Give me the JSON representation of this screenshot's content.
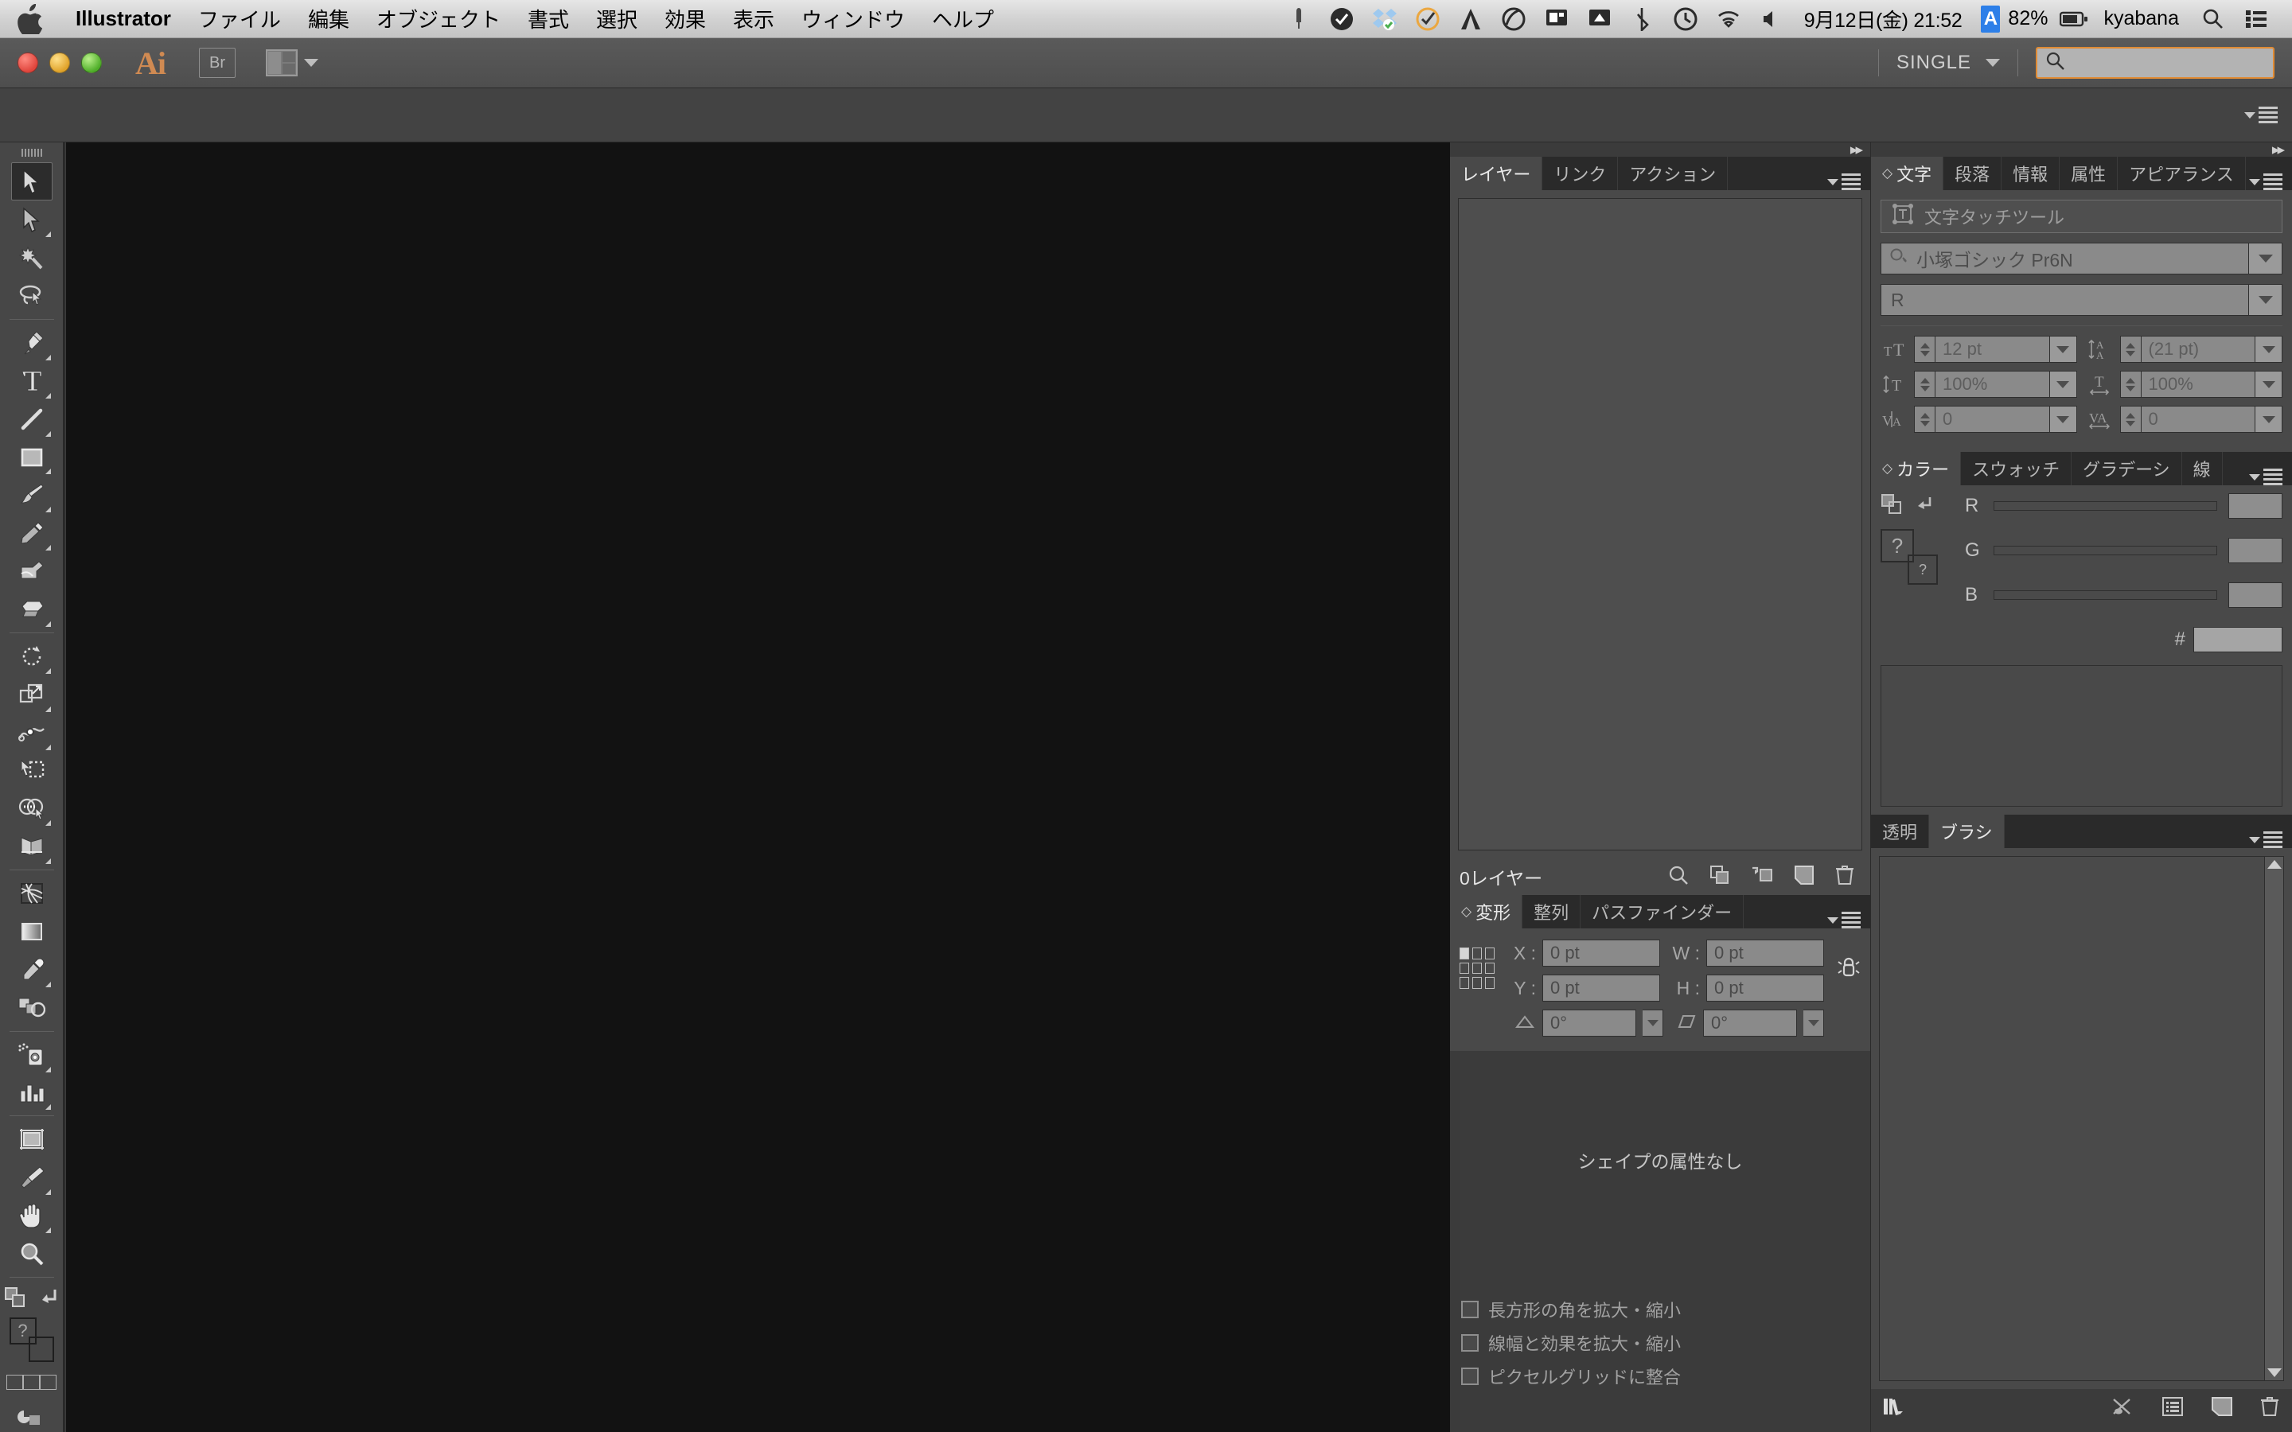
{
  "macbar": {
    "apple_icon": "apple-logo-icon",
    "app_name": "Illustrator",
    "menus": [
      "ファイル",
      "編集",
      "オブジェクト",
      "書式",
      "選択",
      "効果",
      "表示",
      "ウィンドウ",
      "ヘルプ"
    ],
    "status_icons": [
      "bell-icon",
      "checkmark-circle-icon",
      "dropbox-icon",
      "checkmark-orange-icon",
      "app-a-icon",
      "creative-cloud-icon",
      "display-icon",
      "airplay-icon",
      "bluetooth-icon",
      "timemachine-icon",
      "wifi-icon",
      "volume-icon"
    ],
    "clock": "9月12日(金) 21:52",
    "ime": "A",
    "battery_pct": "82%",
    "battery_icon": "battery-icon",
    "user": "kyabana",
    "spotlight_icon": "search-icon",
    "notification_icon": "list-icon"
  },
  "titlebar": {
    "app_logo": "Ai",
    "bridge_label": "Br",
    "arrange_icon": "arrange-documents-icon",
    "workspace": "SINGLE",
    "workspace_caret": "chevron-down-icon",
    "search_icon": "search-icon",
    "search_value": "",
    "search_placeholder": ""
  },
  "control_bar": {
    "panel_menu_icon": "panel-menu-icon"
  },
  "toolbar": {
    "tools": [
      {
        "name": "selection-tool",
        "active": true,
        "has_flyout": false
      },
      {
        "name": "direct-selection-tool",
        "active": false,
        "has_flyout": true
      },
      {
        "name": "magic-wand-tool",
        "active": false,
        "has_flyout": false
      },
      {
        "name": "lasso-tool",
        "active": false,
        "has_flyout": false
      },
      {
        "name": "pen-tool",
        "active": false,
        "has_flyout": true
      },
      {
        "name": "type-tool",
        "active": false,
        "has_flyout": true
      },
      {
        "name": "line-segment-tool",
        "active": false,
        "has_flyout": true
      },
      {
        "name": "rectangle-tool",
        "active": false,
        "has_flyout": true
      },
      {
        "name": "paintbrush-tool",
        "active": false,
        "has_flyout": true
      },
      {
        "name": "pencil-tool",
        "active": false,
        "has_flyout": true
      },
      {
        "name": "blob-brush-tool",
        "active": false,
        "has_flyout": false
      },
      {
        "name": "eraser-tool",
        "active": false,
        "has_flyout": true
      },
      {
        "name": "rotate-tool",
        "active": false,
        "has_flyout": true
      },
      {
        "name": "scale-tool",
        "active": false,
        "has_flyout": true
      },
      {
        "name": "width-tool",
        "active": false,
        "has_flyout": true
      },
      {
        "name": "free-transform-tool",
        "active": false,
        "has_flyout": false
      },
      {
        "name": "shape-builder-tool",
        "active": false,
        "has_flyout": true
      },
      {
        "name": "perspective-grid-tool",
        "active": false,
        "has_flyout": true
      },
      {
        "name": "mesh-tool",
        "active": false,
        "has_flyout": false
      },
      {
        "name": "gradient-tool",
        "active": false,
        "has_flyout": false
      },
      {
        "name": "eyedropper-tool",
        "active": false,
        "has_flyout": true
      },
      {
        "name": "blend-tool",
        "active": false,
        "has_flyout": false
      },
      {
        "name": "symbol-sprayer-tool",
        "active": false,
        "has_flyout": true
      },
      {
        "name": "column-graph-tool",
        "active": false,
        "has_flyout": true
      },
      {
        "name": "artboard-tool",
        "active": false,
        "has_flyout": false
      },
      {
        "name": "slice-tool",
        "active": false,
        "has_flyout": true
      },
      {
        "name": "hand-tool",
        "active": false,
        "has_flyout": true
      },
      {
        "name": "zoom-tool",
        "active": false,
        "has_flyout": false
      }
    ],
    "fill_stroke": {
      "swap_icon": "swap-fill-stroke-icon",
      "default_icon": "default-fill-stroke-icon",
      "fill_label": "?",
      "stroke_label": "?",
      "color_modes": [
        "color-mode-icon",
        "gradient-mode-icon",
        "none-mode-icon"
      ],
      "draw_mode_icon": "draw-normal-icon"
    }
  },
  "layers_panel": {
    "tabs": [
      {
        "label": "レイヤー",
        "active": true
      },
      {
        "label": "リンク",
        "active": false
      },
      {
        "label": "アクション",
        "active": false
      }
    ],
    "menu_icon": "panel-menu-icon",
    "count_label": "0レイヤー",
    "footer_icons": [
      "locate-object-icon",
      "make-clipping-mask-icon",
      "create-sublayer-icon",
      "create-new-layer-icon",
      "delete-layer-icon"
    ]
  },
  "transform_panel": {
    "tabs": [
      {
        "label": "変形",
        "active": true
      },
      {
        "label": "整列",
        "active": false
      },
      {
        "label": "パスファインダー",
        "active": false
      }
    ],
    "menu_icon": "panel-menu-icon",
    "anchor_icon": "reference-point-icon",
    "fields": [
      {
        "label": "X :",
        "value": "0 pt",
        "name": "transform-x-field"
      },
      {
        "label": "W :",
        "value": "0 pt",
        "name": "transform-w-field"
      },
      {
        "label": "Y :",
        "value": "0 pt",
        "name": "transform-y-field"
      },
      {
        "label": "H :",
        "value": "0 pt",
        "name": "transform-h-field"
      }
    ],
    "angle_label_icon": "rotate-angle-icon",
    "angle_value": "0°",
    "shear_label_icon": "shear-angle-icon",
    "shear_value": "0°",
    "link_icon": "constrain-proportions-icon",
    "empty_text": "シェイプの属性なし",
    "checkboxes": [
      {
        "label": "長方形の角を拡大・縮小",
        "checked": false,
        "name": "scale-rectangle-corners-checkbox"
      },
      {
        "label": "線幅と効果を拡大・縮小",
        "checked": false,
        "name": "scale-strokes-effects-checkbox"
      },
      {
        "label": "ピクセルグリッドに整合",
        "checked": false,
        "name": "align-pixel-grid-checkbox"
      }
    ]
  },
  "character_panel": {
    "tabs": [
      {
        "label": "文字",
        "active": true
      },
      {
        "label": "段落",
        "active": false
      },
      {
        "label": "情報",
        "active": false
      },
      {
        "label": "属性",
        "active": false
      },
      {
        "label": "アピアランス",
        "active": false
      }
    ],
    "menu_icon": "panel-menu-icon",
    "touch_type_label": "文字タッチツール",
    "touch_type_icon": "touch-type-tool-icon",
    "font_family": "小塚ゴシック Pr6N",
    "font_style": "R",
    "metrics": [
      {
        "icon": "font-size-icon",
        "value": "12 pt",
        "name": "font-size-field"
      },
      {
        "icon": "leading-icon",
        "value": "(21 pt)",
        "name": "leading-field"
      },
      {
        "icon": "vertical-scale-icon",
        "value": "100%",
        "name": "vertical-scale-field"
      },
      {
        "icon": "horizontal-scale-icon",
        "value": "100%",
        "name": "horizontal-scale-field"
      },
      {
        "icon": "kerning-icon",
        "value": "0",
        "name": "kerning-field"
      },
      {
        "icon": "tracking-icon",
        "value": "0",
        "name": "tracking-field"
      }
    ]
  },
  "color_panel": {
    "tabs": [
      {
        "label": "カラー",
        "active": true
      },
      {
        "label": "スウォッチ",
        "active": false
      },
      {
        "label": "グラデーシ",
        "active": false
      },
      {
        "label": "線",
        "active": false
      }
    ],
    "menu_icon": "panel-menu-icon",
    "fill_stroke_icon": "fill-stroke-icon",
    "none_icon": "none-color-icon",
    "unknown_icon": "unknown-color-icon",
    "sliders": [
      {
        "label": "R",
        "value": "",
        "name": "red-slider"
      },
      {
        "label": "G",
        "value": "",
        "name": "green-slider"
      },
      {
        "label": "B",
        "value": "",
        "name": "blue-slider"
      }
    ],
    "hex_label": "#",
    "hex_value": ""
  },
  "brushes_panel": {
    "tabs": [
      {
        "label": "透明",
        "active": false
      },
      {
        "label": "ブラシ",
        "active": true
      }
    ],
    "menu_icon": "panel-menu-icon",
    "footer_icons": [
      "brush-libraries-icon",
      "remove-brush-stroke-icon",
      "options-icon",
      "new-brush-icon",
      "delete-brush-icon"
    ],
    "scroll_up_icon": "scroll-up-icon",
    "scroll_down_icon": "scroll-down-icon"
  },
  "colors": {
    "accent_orange": "#e08b34",
    "ai_logo": "#d08a52",
    "panel_bg": "#494949",
    "tab_bg": "#2a2a2a",
    "canvas_bg": "#121212",
    "toolbar_bg": "#474747"
  }
}
